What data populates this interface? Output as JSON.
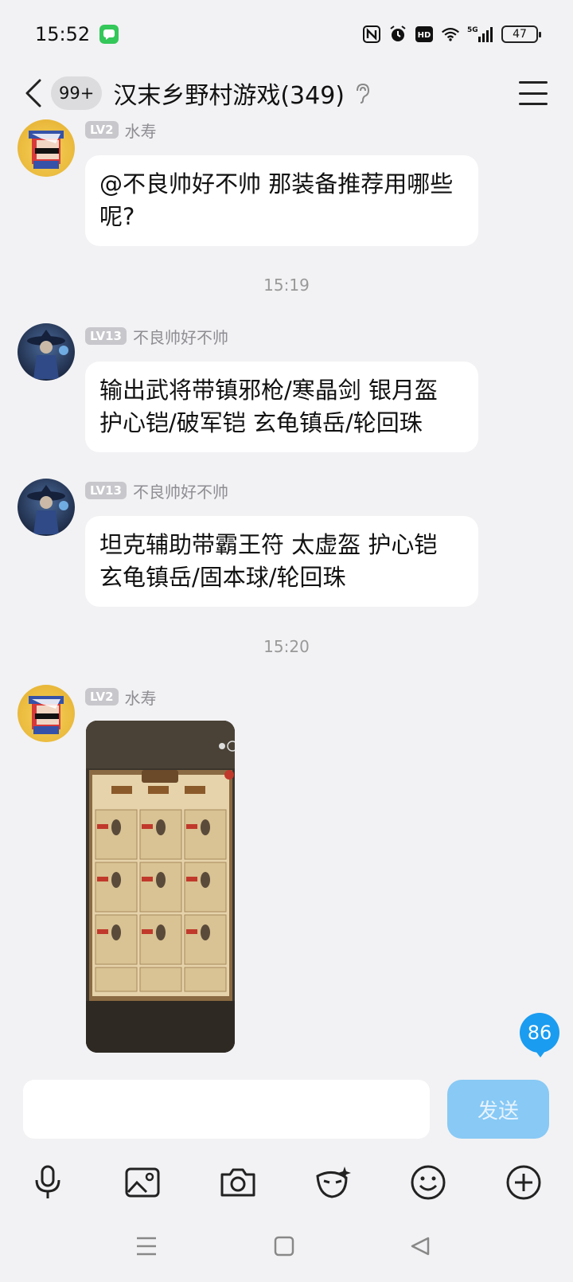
{
  "status_bar": {
    "time": "15:52",
    "network": "5G",
    "battery": "47",
    "icons": [
      "messages-app-icon",
      "nfc-icon",
      "alarm-icon",
      "hd-icon",
      "wifi-icon",
      "signal-icon",
      "battery-icon"
    ]
  },
  "header": {
    "unread_count": "99+",
    "title": "汉末乡野村游戏(349)",
    "icons": [
      "back-icon",
      "ear-icon",
      "menu-icon"
    ]
  },
  "messages": [
    {
      "sender": "水寿",
      "level": "LV2",
      "text": "@不良帅好不帅 那装备推荐用哪些呢?"
    },
    {
      "timestamp": "15:19"
    },
    {
      "sender": "不良帅好不帅",
      "level": "LV13",
      "text": "输出武将带镇邪枪/寒晶剑 银月盔 护心铠/破军铠 玄龟镇岳/轮回珠"
    },
    {
      "sender": "不良帅好不帅",
      "level": "LV13",
      "text": "坦克辅助带霸王符 太虚盔 护心铠 玄龟镇岳/固本球/轮回珠"
    },
    {
      "timestamp": "15:20"
    },
    {
      "sender": "水寿",
      "level": "LV2",
      "image": "game-screenshot"
    }
  ],
  "new_message_badge": "86",
  "input": {
    "placeholder": "",
    "send_label": "发送"
  },
  "toolbar_icons": [
    "microphone-icon",
    "image-icon",
    "camera-icon",
    "mask-icon",
    "emoji-icon",
    "plus-icon"
  ],
  "nav_icons": [
    "recent-apps-icon",
    "home-icon",
    "back-nav-icon"
  ],
  "colors": {
    "background": "#f2f2f4",
    "bubble": "#ffffff",
    "send_button": "#88c9f5",
    "badge": "#1a9cf0",
    "level_badge": "#c7c7cc"
  }
}
